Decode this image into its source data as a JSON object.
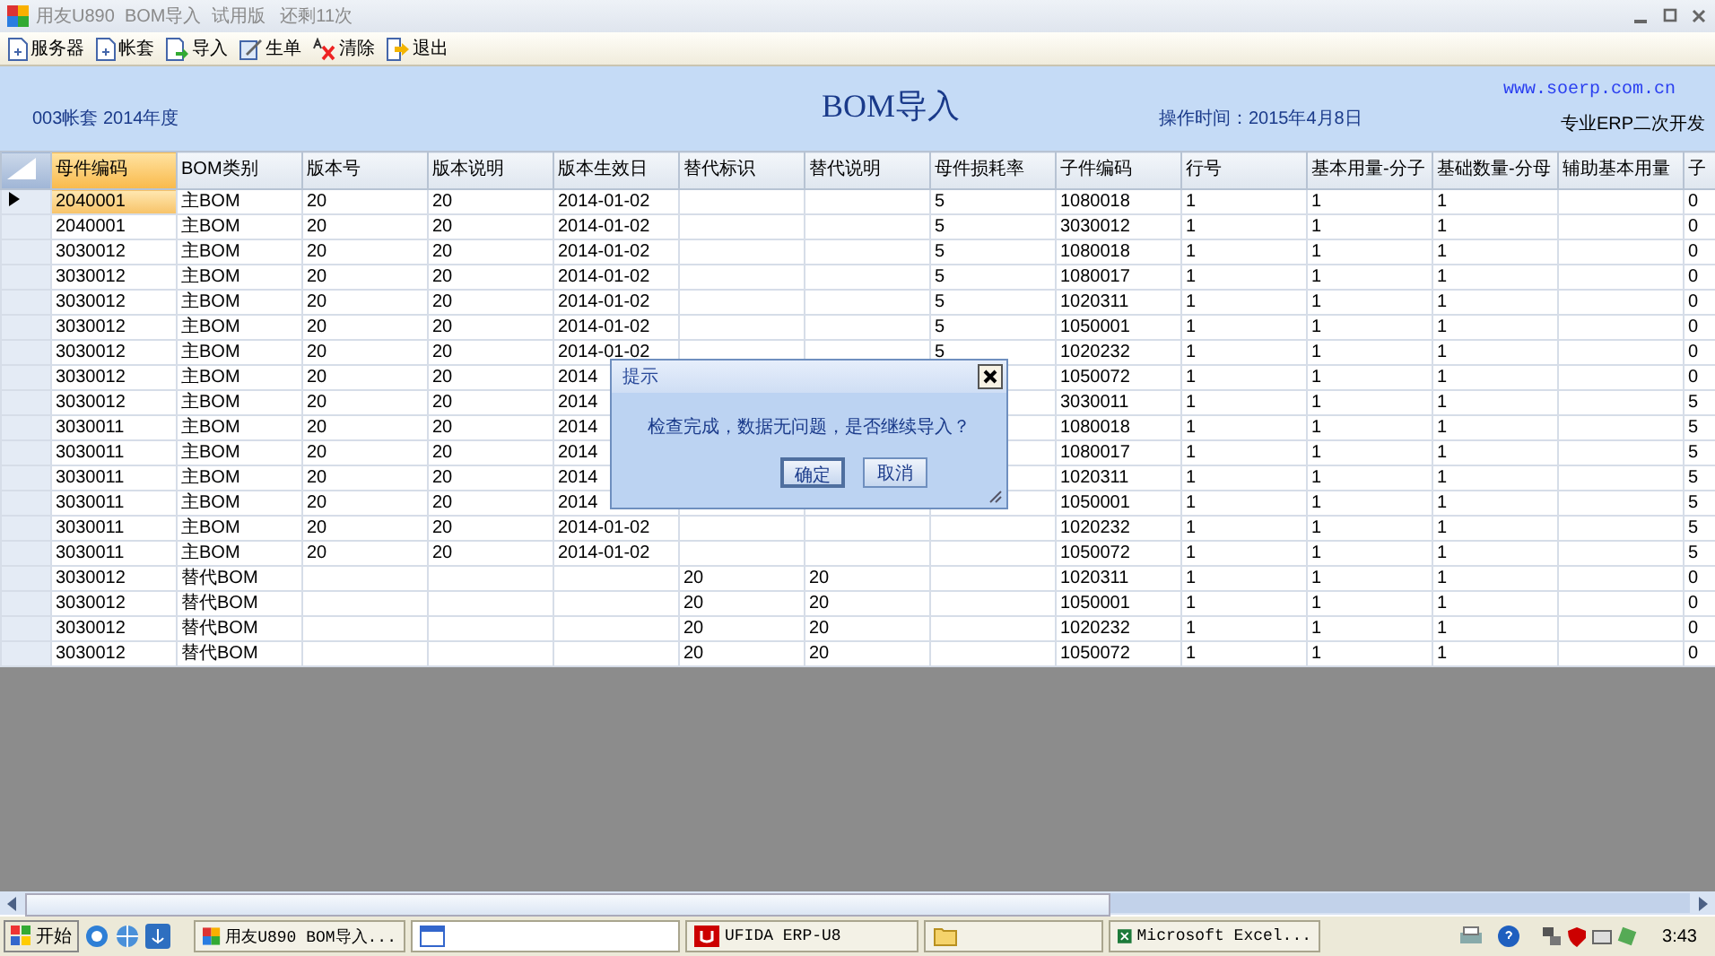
{
  "window": {
    "title": "用友U890  BOM导入  试用版   还剩11次"
  },
  "toolbar": [
    {
      "label": "服务器",
      "kind": "doc"
    },
    {
      "label": "帐套",
      "kind": "doc"
    },
    {
      "label": "导入",
      "kind": "import"
    },
    {
      "label": "生单",
      "kind": "edit"
    },
    {
      "label": "清除",
      "kind": "clear"
    },
    {
      "label": "退出",
      "kind": "exit"
    }
  ],
  "header": {
    "account": "003帐套 2014年度",
    "title": "BOM导入",
    "op_time": "操作时间：2015年4月8日",
    "website": "www.soerp.com.cn",
    "slogan": "专业ERP二次开发"
  },
  "table": {
    "columns": [
      {
        "label": "母件编码",
        "selected": true
      },
      {
        "label": "BOM类别",
        "selected": false
      },
      {
        "label": "版本号",
        "selected": false
      },
      {
        "label": "版本说明",
        "selected": false
      },
      {
        "label": "版本生效日",
        "selected": false
      },
      {
        "label": "替代标识",
        "selected": false
      },
      {
        "label": "替代说明",
        "selected": false
      },
      {
        "label": "母件损耗率",
        "selected": false
      },
      {
        "label": "子件编码",
        "selected": false
      },
      {
        "label": "行号",
        "selected": false
      },
      {
        "label": "基本用量-分子",
        "selected": false
      },
      {
        "label": "基础数量-分母",
        "selected": false
      },
      {
        "label": "辅助基本用量",
        "selected": false
      },
      {
        "label": "子",
        "selected": false
      }
    ],
    "rows": [
      {
        "selected": true,
        "cells": [
          "2040001",
          "主BOM",
          "20",
          "20",
          "2014-01-02",
          "",
          "",
          "5",
          "1080018",
          "1",
          "1",
          "1",
          "",
          "0"
        ]
      },
      {
        "selected": false,
        "cells": [
          "2040001",
          "主BOM",
          "20",
          "20",
          "2014-01-02",
          "",
          "",
          "5",
          "3030012",
          "1",
          "1",
          "1",
          "",
          "0"
        ]
      },
      {
        "selected": false,
        "cells": [
          "3030012",
          "主BOM",
          "20",
          "20",
          "2014-01-02",
          "",
          "",
          "5",
          "1080018",
          "1",
          "1",
          "1",
          "",
          "0"
        ]
      },
      {
        "selected": false,
        "cells": [
          "3030012",
          "主BOM",
          "20",
          "20",
          "2014-01-02",
          "",
          "",
          "5",
          "1080017",
          "1",
          "1",
          "1",
          "",
          "0"
        ]
      },
      {
        "selected": false,
        "cells": [
          "3030012",
          "主BOM",
          "20",
          "20",
          "2014-01-02",
          "",
          "",
          "5",
          "1020311",
          "1",
          "1",
          "1",
          "",
          "0"
        ]
      },
      {
        "selected": false,
        "cells": [
          "3030012",
          "主BOM",
          "20",
          "20",
          "2014-01-02",
          "",
          "",
          "5",
          "1050001",
          "1",
          "1",
          "1",
          "",
          "0"
        ]
      },
      {
        "selected": false,
        "cells": [
          "3030012",
          "主BOM",
          "20",
          "20",
          "2014-01-02",
          "",
          "",
          "5",
          "1020232",
          "1",
          "1",
          "1",
          "",
          "0"
        ]
      },
      {
        "selected": false,
        "cells": [
          "3030012",
          "主BOM",
          "20",
          "20",
          "2014",
          null,
          null,
          null,
          "1050072",
          "1",
          "1",
          "1",
          "",
          "0"
        ]
      },
      {
        "selected": false,
        "cells": [
          "3030012",
          "主BOM",
          "20",
          "20",
          "2014",
          null,
          null,
          null,
          "3030011",
          "1",
          "1",
          "1",
          "",
          "5"
        ]
      },
      {
        "selected": false,
        "cells": [
          "3030011",
          "主BOM",
          "20",
          "20",
          "2014",
          null,
          null,
          null,
          "1080018",
          "1",
          "1",
          "1",
          "",
          "5"
        ]
      },
      {
        "selected": false,
        "cells": [
          "3030011",
          "主BOM",
          "20",
          "20",
          "2014",
          null,
          null,
          null,
          "1080017",
          "1",
          "1",
          "1",
          "",
          "5"
        ]
      },
      {
        "selected": false,
        "cells": [
          "3030011",
          "主BOM",
          "20",
          "20",
          "2014",
          null,
          null,
          null,
          "1020311",
          "1",
          "1",
          "1",
          "",
          "5"
        ]
      },
      {
        "selected": false,
        "cells": [
          "3030011",
          "主BOM",
          "20",
          "20",
          "2014",
          null,
          null,
          null,
          "1050001",
          "1",
          "1",
          "1",
          "",
          "5"
        ]
      },
      {
        "selected": false,
        "cells": [
          "3030011",
          "主BOM",
          "20",
          "20",
          "2014-01-02",
          "",
          "",
          "",
          "1020232",
          "1",
          "1",
          "1",
          "",
          "5"
        ]
      },
      {
        "selected": false,
        "cells": [
          "3030011",
          "主BOM",
          "20",
          "20",
          "2014-01-02",
          "",
          "",
          "",
          "1050072",
          "1",
          "1",
          "1",
          "",
          "5"
        ]
      },
      {
        "selected": false,
        "cells": [
          "3030012",
          "替代BOM",
          "",
          "",
          "",
          "20",
          "20",
          "",
          "1020311",
          "1",
          "1",
          "1",
          "",
          "0"
        ]
      },
      {
        "selected": false,
        "cells": [
          "3030012",
          "替代BOM",
          "",
          "",
          "",
          "20",
          "20",
          "",
          "1050001",
          "1",
          "1",
          "1",
          "",
          "0"
        ]
      },
      {
        "selected": false,
        "cells": [
          "3030012",
          "替代BOM",
          "",
          "",
          "",
          "20",
          "20",
          "",
          "1020232",
          "1",
          "1",
          "1",
          "",
          "0"
        ]
      },
      {
        "selected": false,
        "cells": [
          "3030012",
          "替代BOM",
          "",
          "",
          "",
          "20",
          "20",
          "",
          "1050072",
          "1",
          "1",
          "1",
          "",
          "0"
        ]
      }
    ]
  },
  "dialog": {
    "title": "提示",
    "message": "检查完成，数据无问题，是否继续导入？",
    "buttons": [
      {
        "label": "确定",
        "selected": true
      },
      {
        "label": "取消",
        "selected": false
      }
    ]
  },
  "taskbar": {
    "start": "开始",
    "tasks": [
      {
        "label": "用友U890 BOM导入...",
        "kind": "app"
      },
      {
        "kind": "window"
      },
      {
        "label": "UFIDA ERP-U8",
        "kind": "ufida"
      },
      {
        "kind": "folder"
      },
      {
        "label": "Microsoft Excel...",
        "kind": "excel"
      }
    ],
    "clock": "3:43"
  }
}
